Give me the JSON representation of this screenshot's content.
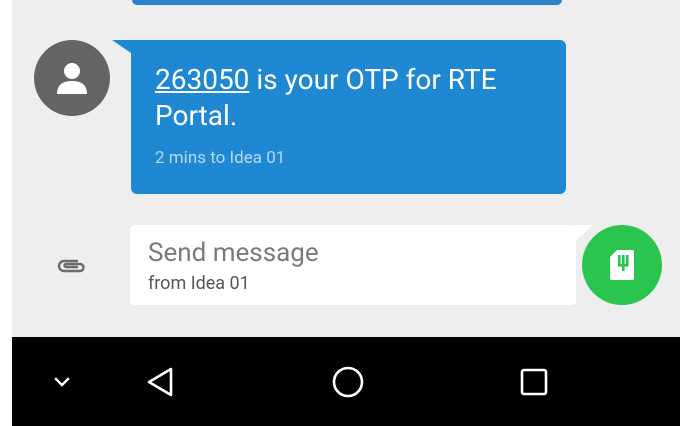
{
  "message": {
    "otp": "263050",
    "text_after_otp": " is your OTP for RTE Portal.",
    "meta": "2 mins to Idea 01"
  },
  "compose": {
    "placeholder": "Send message",
    "sim_label": "from Idea 01"
  },
  "colors": {
    "bubble": "#1e88d2",
    "send_button": "#2ac54f",
    "chat_background": "#eeeeee",
    "navbar": "#000000"
  },
  "icons": {
    "avatar": "person-icon",
    "attach": "paperclip-icon",
    "send": "sim-card-icon",
    "nav": [
      "chevron-down-icon",
      "back-triangle-icon",
      "home-circle-icon",
      "recents-square-icon"
    ]
  }
}
